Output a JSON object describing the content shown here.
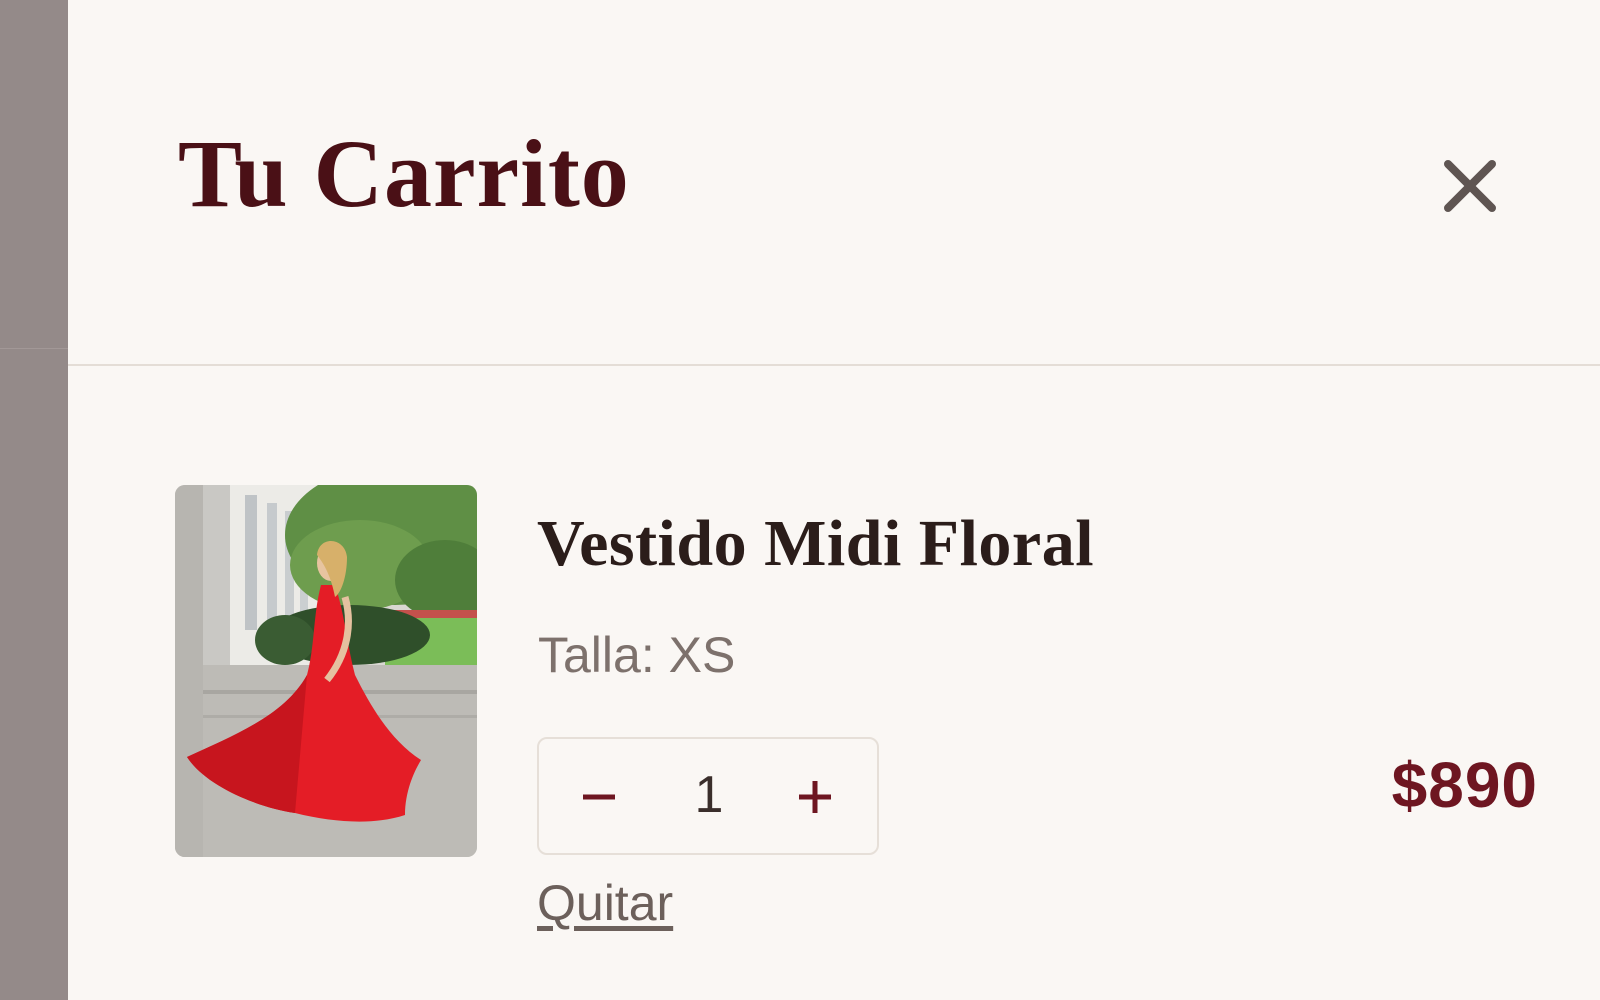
{
  "cart": {
    "title": "Tu Carrito",
    "close_icon": "close-icon",
    "items": [
      {
        "image_icon": "product-photo-red-dress",
        "name": "Vestido Midi Floral",
        "size_label": "Talla: XS",
        "quantity": "1",
        "decrement_icon": "minus-icon",
        "increment_icon": "plus-icon",
        "price": "$890",
        "remove_label": "Quitar"
      }
    ]
  },
  "colors": {
    "drawer_background": "#faf7f4",
    "title": "#4a1016",
    "accent": "#6e1621",
    "muted_text": "#7d716c",
    "overlay": "#948a89"
  }
}
